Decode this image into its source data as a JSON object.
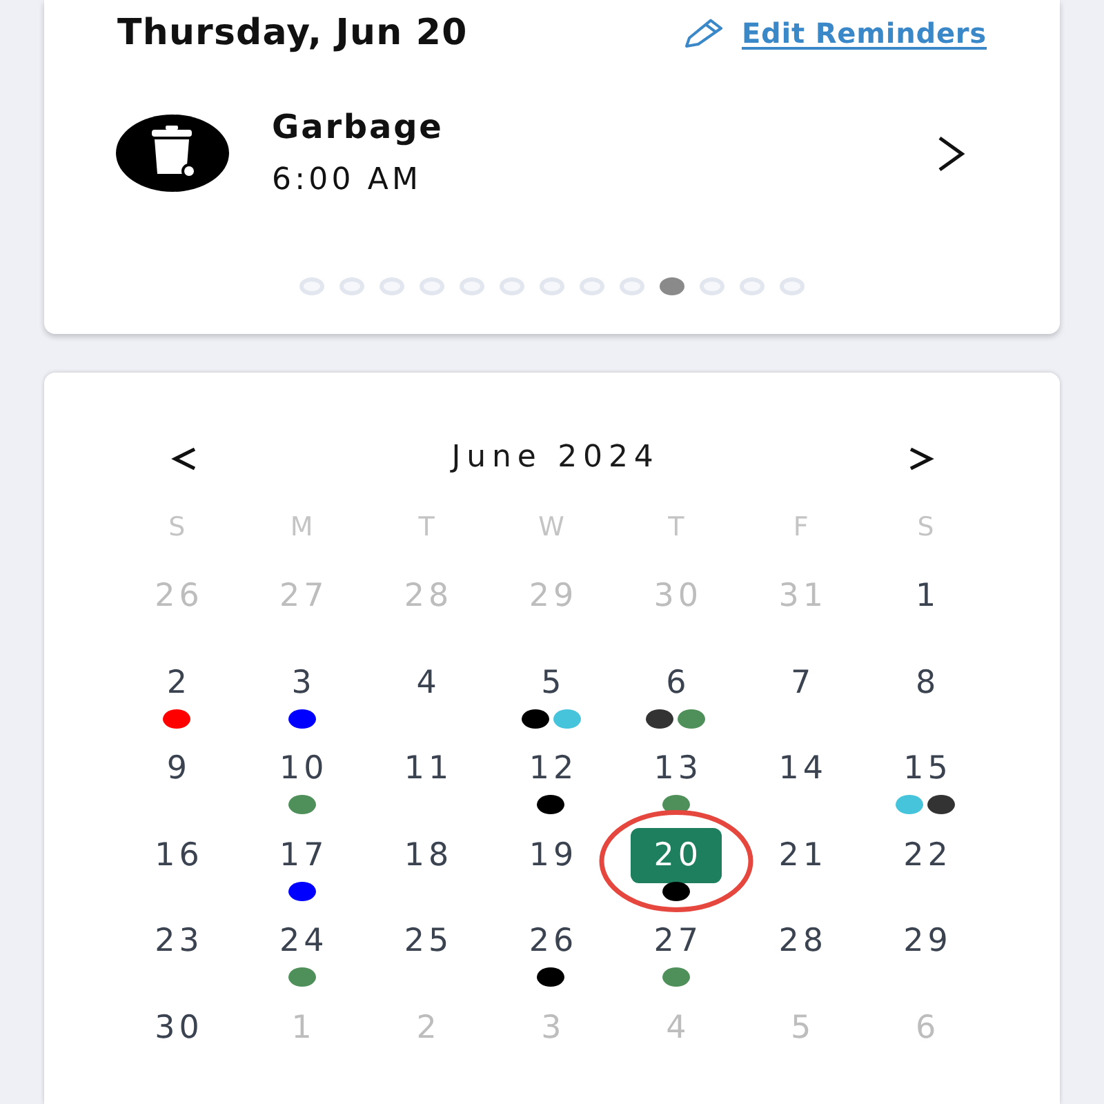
{
  "header": {
    "date": "Thursday, Jun 20",
    "edit_link": "Edit Reminders"
  },
  "reminder": {
    "title": "Garbage",
    "time": "6:00 AM"
  },
  "pager": {
    "dots": [
      {
        "selected": false
      },
      {
        "selected": false
      },
      {
        "selected": false
      },
      {
        "selected": false
      },
      {
        "selected": false
      },
      {
        "selected": false
      },
      {
        "selected": false
      },
      {
        "selected": false
      },
      {
        "selected": false
      },
      {
        "selected": true
      },
      {
        "selected": false
      },
      {
        "selected": false
      },
      {
        "selected": false
      }
    ]
  },
  "calendar": {
    "month": "June 2024",
    "weekdays": [
      "S",
      "M",
      "T",
      "W",
      "T",
      "F",
      "S"
    ],
    "weeks": [
      {
        "days": [
          {
            "label": "26",
            "in_month": false,
            "selected": false,
            "circled": false
          },
          {
            "label": "27",
            "in_month": false,
            "selected": false,
            "circled": false
          },
          {
            "label": "28",
            "in_month": false,
            "selected": false,
            "circled": false
          },
          {
            "label": "29",
            "in_month": false,
            "selected": false,
            "circled": false
          },
          {
            "label": "30",
            "in_month": false,
            "selected": false,
            "circled": false
          },
          {
            "label": "31",
            "in_month": false,
            "selected": false,
            "circled": false
          },
          {
            "label": "1",
            "in_month": true,
            "selected": false,
            "circled": false
          }
        ]
      },
      {
        "days": [
          {
            "label": "2",
            "in_month": true,
            "selected": false,
            "circled": false,
            "events": [
              {
                "color": "#ff0000"
              }
            ]
          },
          {
            "label": "3",
            "in_month": true,
            "selected": false,
            "circled": false,
            "events": [
              {
                "color": "#0000ff"
              }
            ]
          },
          {
            "label": "4",
            "in_month": true,
            "selected": false,
            "circled": false
          },
          {
            "label": "5",
            "in_month": true,
            "selected": false,
            "circled": false,
            "events": [
              {
                "color": "#000000"
              },
              {
                "color": "#45c4dc"
              }
            ]
          },
          {
            "label": "6",
            "in_month": true,
            "selected": false,
            "circled": false,
            "events": [
              {
                "color": "#333333"
              },
              {
                "color": "#4f8f5a"
              }
            ]
          },
          {
            "label": "7",
            "in_month": true,
            "selected": false,
            "circled": false
          },
          {
            "label": "8",
            "in_month": true,
            "selected": false,
            "circled": false
          }
        ]
      },
      {
        "days": [
          {
            "label": "9",
            "in_month": true,
            "selected": false,
            "circled": false
          },
          {
            "label": "10",
            "in_month": true,
            "selected": false,
            "circled": false,
            "events": [
              {
                "color": "#4f8f5a"
              }
            ]
          },
          {
            "label": "11",
            "in_month": true,
            "selected": false,
            "circled": false
          },
          {
            "label": "12",
            "in_month": true,
            "selected": false,
            "circled": false,
            "events": [
              {
                "color": "#000000"
              }
            ]
          },
          {
            "label": "13",
            "in_month": true,
            "selected": false,
            "circled": false,
            "events": [
              {
                "color": "#4f8f5a"
              }
            ]
          },
          {
            "label": "14",
            "in_month": true,
            "selected": false,
            "circled": false
          },
          {
            "label": "15",
            "in_month": true,
            "selected": false,
            "circled": false,
            "events": [
              {
                "color": "#45c4dc"
              },
              {
                "color": "#333333"
              }
            ]
          }
        ]
      },
      {
        "days": [
          {
            "label": "16",
            "in_month": true,
            "selected": false,
            "circled": false
          },
          {
            "label": "17",
            "in_month": true,
            "selected": false,
            "circled": false,
            "events": [
              {
                "color": "#0000ff"
              }
            ]
          },
          {
            "label": "18",
            "in_month": true,
            "selected": false,
            "circled": false
          },
          {
            "label": "19",
            "in_month": true,
            "selected": false,
            "circled": false
          },
          {
            "label": "20",
            "in_month": true,
            "selected": true,
            "circled": true,
            "events": [
              {
                "color": "#000000"
              }
            ]
          },
          {
            "label": "21",
            "in_month": true,
            "selected": false,
            "circled": false
          },
          {
            "label": "22",
            "in_month": true,
            "selected": false,
            "circled": false
          }
        ]
      },
      {
        "days": [
          {
            "label": "23",
            "in_month": true,
            "selected": false,
            "circled": false
          },
          {
            "label": "24",
            "in_month": true,
            "selected": false,
            "circled": false,
            "events": [
              {
                "color": "#4f8f5a"
              }
            ]
          },
          {
            "label": "25",
            "in_month": true,
            "selected": false,
            "circled": false
          },
          {
            "label": "26",
            "in_month": true,
            "selected": false,
            "circled": false,
            "events": [
              {
                "color": "#000000"
              }
            ]
          },
          {
            "label": "27",
            "in_month": true,
            "selected": false,
            "circled": false,
            "events": [
              {
                "color": "#4f8f5a"
              }
            ]
          },
          {
            "label": "28",
            "in_month": true,
            "selected": false,
            "circled": false
          },
          {
            "label": "29",
            "in_month": true,
            "selected": false,
            "circled": false
          }
        ]
      },
      {
        "days": [
          {
            "label": "30",
            "in_month": true,
            "selected": false,
            "circled": false
          },
          {
            "label": "1",
            "in_month": false,
            "selected": false,
            "circled": false
          },
          {
            "label": "2",
            "in_month": false,
            "selected": false,
            "circled": false
          },
          {
            "label": "3",
            "in_month": false,
            "selected": false,
            "circled": false
          },
          {
            "label": "4",
            "in_month": false,
            "selected": false,
            "circled": false
          },
          {
            "label": "5",
            "in_month": false,
            "selected": false,
            "circled": false
          },
          {
            "label": "6",
            "in_month": false,
            "selected": false,
            "circled": false
          }
        ]
      }
    ]
  }
}
